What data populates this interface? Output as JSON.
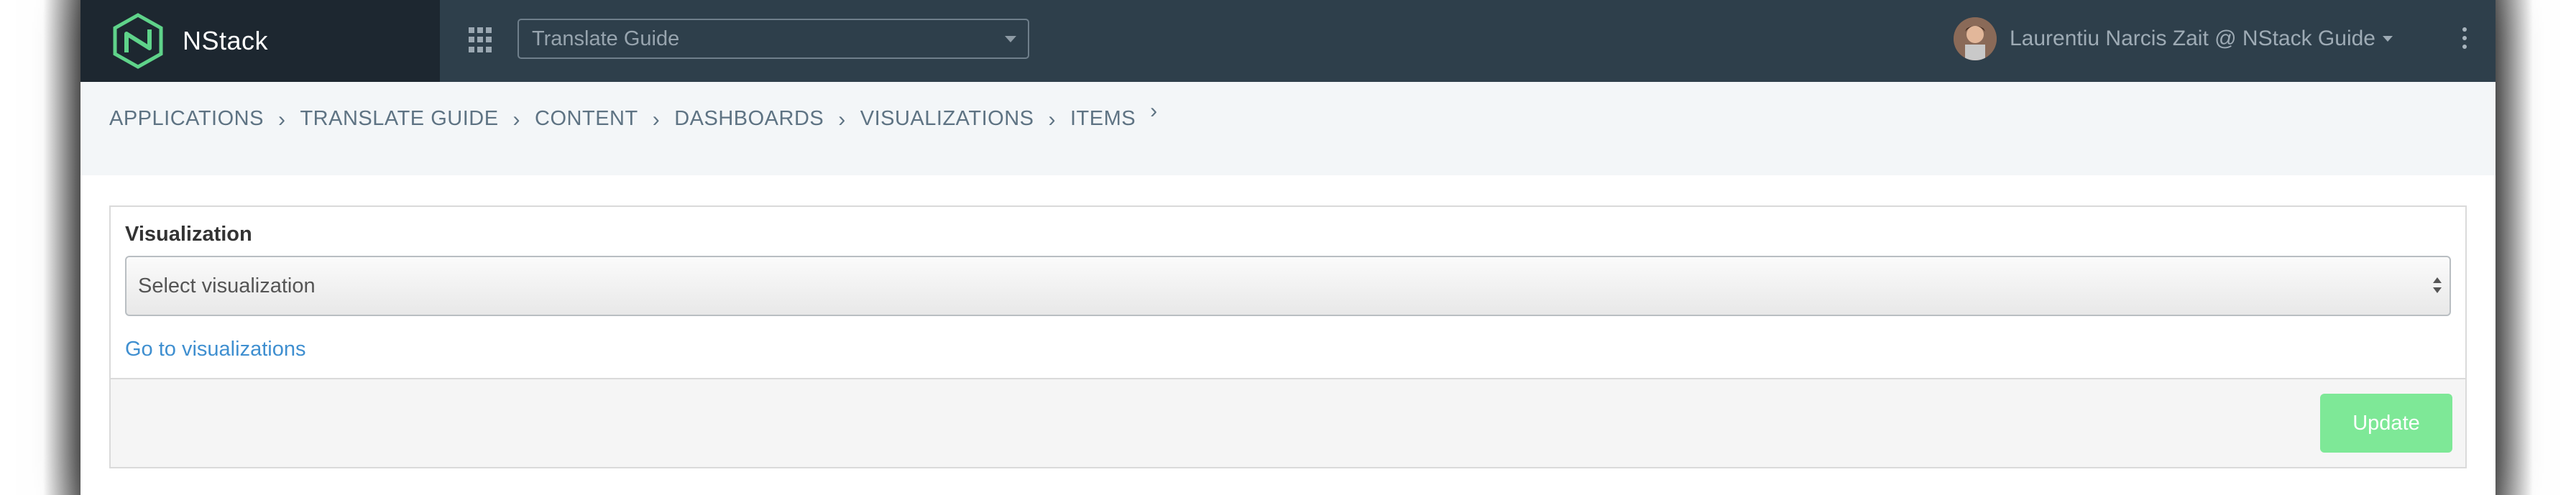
{
  "navbar": {
    "brand_name": "NStack",
    "apps_icon": "grid-icon",
    "app_select_value": "Translate Guide",
    "user_name": "Laurentiu Narcis Zait @ NStack Guide",
    "menu_icon": "kebab-menu-icon"
  },
  "breadcrumb": {
    "items": [
      "APPLICATIONS",
      "TRANSLATE GUIDE",
      "CONTENT",
      "DASHBOARDS",
      "VISUALIZATIONS",
      "ITEMS"
    ],
    "separator": "›"
  },
  "form": {
    "visualization_label": "Visualization",
    "visualization_select_value": "Select visualization",
    "goto_link": "Go to visualizations",
    "update_label": "Update"
  },
  "colors": {
    "navbar": "#2e3f4b",
    "brand_bg": "#1d2730",
    "logo_green": "#5fd38a",
    "link": "#3f8fd0",
    "update_button": "#7ee897"
  }
}
